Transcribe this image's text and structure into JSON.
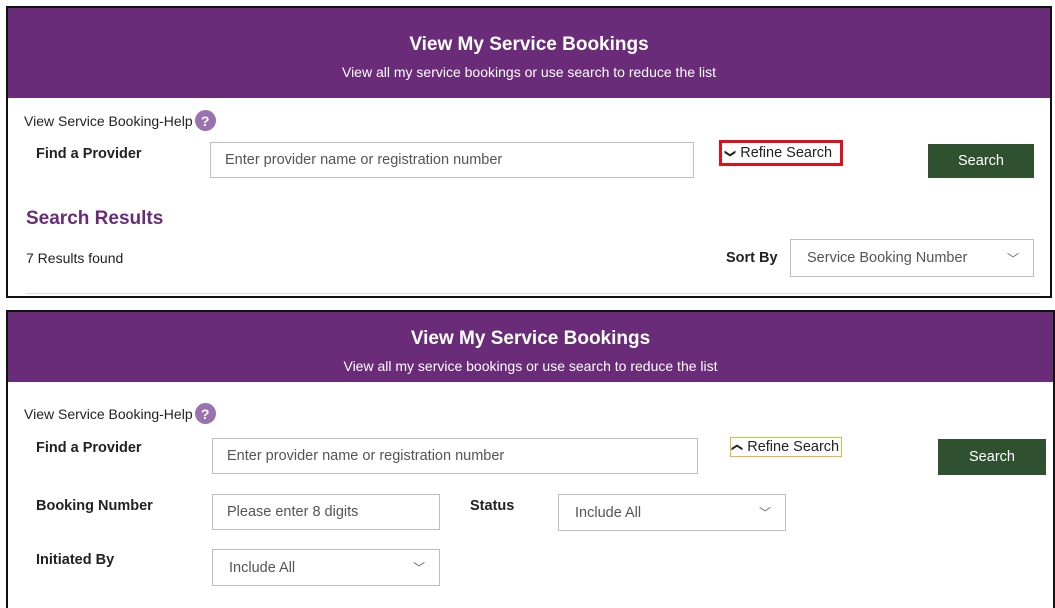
{
  "top_panel": {
    "banner_title": "View My Service Bookings",
    "banner_subtitle": "View all my service bookings or use search to reduce the list",
    "help_label": "View Service Booking-Help",
    "help_icon": "?",
    "find_provider_label": "Find a Provider",
    "provider_placeholder": "Enter provider name or registration number",
    "refine_chevron": "❯",
    "refine_label": "Refine Search",
    "search_button": "Search",
    "results_title": "Search Results",
    "results_count": "7 Results found",
    "sort_by_label": "Sort By",
    "sort_by_value": "Service Booking Number",
    "caret": "﹀"
  },
  "bottom_panel": {
    "banner_title": "View My Service Bookings",
    "banner_subtitle": "View all my service bookings or use search to reduce the list",
    "help_label": "View Service Booking-Help",
    "help_icon": "?",
    "find_provider_label": "Find a Provider",
    "provider_placeholder": "Enter provider name or registration number",
    "refine_chevron": "❮",
    "refine_label": "Refine Search",
    "search_button": "Search",
    "booking_number_label": "Booking Number",
    "booking_number_placeholder": "Please enter 8 digits",
    "status_label": "Status",
    "status_value": "Include All",
    "initiated_by_label": "Initiated By",
    "initiated_by_value": "Include All",
    "caret": "﹀"
  },
  "colors": {
    "banner": "#6a2b78",
    "search_button": "#2f5130",
    "highlight_red": "#e0101a",
    "focus_orange": "#f2b233",
    "help_icon": "#9b72b0"
  }
}
